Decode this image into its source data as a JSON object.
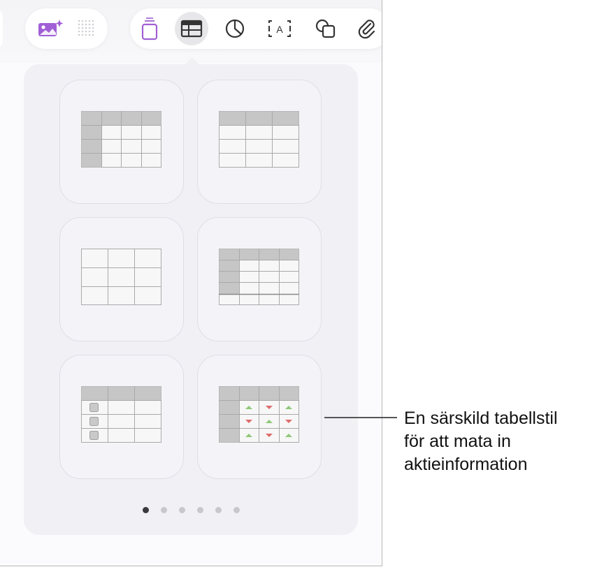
{
  "toolbar": {
    "left_group": [
      {
        "icon": "image-magic-icon",
        "color": "#a05fd6"
      },
      {
        "icon": "dots-grid-icon",
        "color": "#cfcfd4"
      }
    ],
    "right_group": [
      {
        "icon": "tray-icon",
        "color": "#a05fd6"
      },
      {
        "icon": "table-icon",
        "color": "#333333",
        "selected": true
      },
      {
        "icon": "chart-icon",
        "color": "#333333"
      },
      {
        "icon": "text-box-icon",
        "color": "#333333",
        "glyph": "A"
      },
      {
        "icon": "shapes-icon",
        "color": "#333333"
      },
      {
        "icon": "paperclip-icon",
        "color": "#333333"
      }
    ]
  },
  "table_styles": [
    {
      "style": "header-row-and-column"
    },
    {
      "style": "header-row"
    },
    {
      "style": "plain"
    },
    {
      "style": "header-row-column-footer"
    },
    {
      "style": "checklist"
    },
    {
      "style": "stock-arrows"
    }
  ],
  "pagination": {
    "pages": 6,
    "current": 1
  },
  "callout": {
    "lines": [
      "En särskild tabellstil",
      "för att mata in",
      "aktieinformation"
    ]
  },
  "colors": {
    "up_arrow": "#8fc97a",
    "down_arrow": "#e06b6b",
    "accent": "#a05fd6"
  }
}
